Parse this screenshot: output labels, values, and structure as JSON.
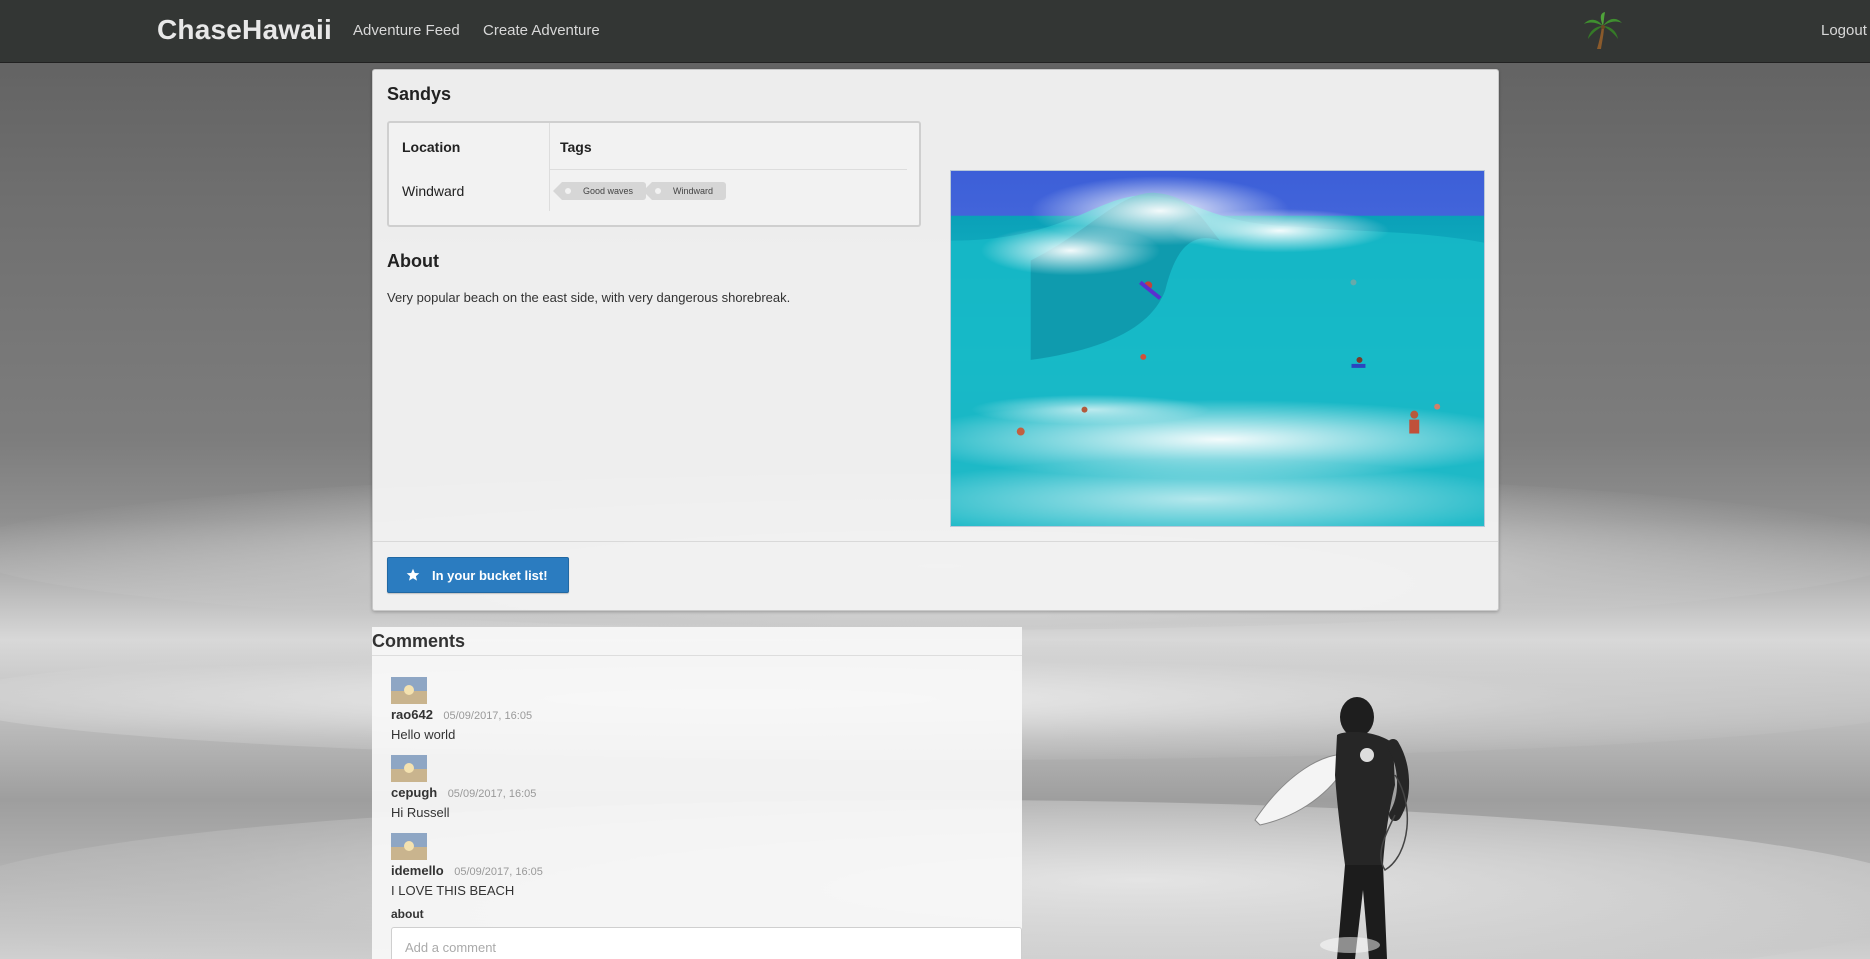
{
  "nav": {
    "brand": "ChaseHawaii",
    "links": [
      "Adventure Feed",
      "Create Adventure"
    ],
    "logout": "Logout",
    "logo_icon": "palm-tree-icon"
  },
  "adventure": {
    "title": "Sandys",
    "table": {
      "location_header": "Location",
      "tags_header": "Tags",
      "location": "Windward",
      "tags": [
        "Good waves",
        "Windward"
      ]
    },
    "about_title": "About",
    "about_text": "Very popular beach on the east side, with very dangerous shorebreak.",
    "bucket_button": "In your bucket list!",
    "bucket_icon": "star-icon"
  },
  "comments": {
    "title": "Comments",
    "items": [
      {
        "author": "rao642",
        "date": "05/09/2017, 16:05",
        "text": "Hello world"
      },
      {
        "author": "cepugh",
        "date": "05/09/2017, 16:05",
        "text": "Hi Russell"
      },
      {
        "author": "idemello",
        "date": "05/09/2017, 16:05",
        "text": "I LOVE THIS BEACH"
      }
    ],
    "about_label": "about",
    "input_placeholder": "Add a comment"
  },
  "colors": {
    "navbar": "#333634",
    "button": "#2b7cc0"
  }
}
